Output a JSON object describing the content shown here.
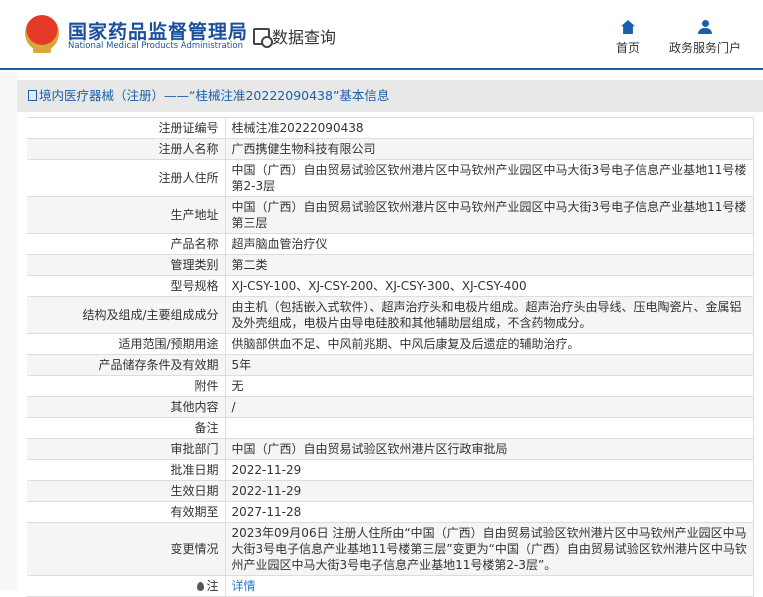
{
  "header": {
    "brand_cn": "国家药品监督管理局",
    "brand_en": "National Medical Products Administration",
    "data_query": "数据查询",
    "nav": [
      {
        "label": "首页",
        "icon": "home-icon"
      },
      {
        "label": "政务服务门户",
        "icon": "user-icon"
      }
    ]
  },
  "title": "境内医疗器械（注册）——“桂械注准20222090438”基本信息",
  "rows": [
    {
      "k": "注册证编号",
      "v": "桂械注准20222090438"
    },
    {
      "k": "注册人名称",
      "v": "广西携健生物科技有限公司"
    },
    {
      "k": "注册人住所",
      "v": "中国（广西）自由贸易试验区钦州港片区中马钦州产业园区中马大街3号电子信息产业基地11号楼第2-3层"
    },
    {
      "k": "生产地址",
      "v": "中国（广西）自由贸易试验区钦州港片区中马钦州产业园区中马大街3号电子信息产业基地11号楼第三层"
    },
    {
      "k": "产品名称",
      "v": "超声脑血管治疗仪"
    },
    {
      "k": "管理类别",
      "v": "第二类"
    },
    {
      "k": "型号规格",
      "v": "XJ-CSY-100、XJ-CSY-200、XJ-CSY-300、XJ-CSY-400"
    },
    {
      "k": "结构及组成/主要组成成分",
      "v": "由主机（包括嵌入式软件）、超声治疗头和电极片组成。超声治疗头由导线、压电陶瓷片、金属铝及外壳组成，电极片由导电硅胶和其他辅助层组成，不含药物成分。"
    },
    {
      "k": "适用范围/预期用途",
      "v": "供脑部供血不足、中风前兆期、中风后康复及后遗症的辅助治疗。"
    },
    {
      "k": "产品储存条件及有效期",
      "v": "5年"
    },
    {
      "k": "附件",
      "v": "无"
    },
    {
      "k": "其他内容",
      "v": "/"
    },
    {
      "k": "备注",
      "v": ""
    },
    {
      "k": "审批部门",
      "v": "中国（广西）自由贸易试验区钦州港片区行政审批局"
    },
    {
      "k": "批准日期",
      "v": "2022-11-29"
    },
    {
      "k": "生效日期",
      "v": "2022-11-29"
    },
    {
      "k": "有效期至",
      "v": "2027-11-28"
    },
    {
      "k": "变更情况",
      "v": "2023年09月06日 注册人住所由“中国（广西）自由贸易试验区钦州港片区中马钦州产业园区中马大街3号电子信息产业基地11号楼第三层”变更为“中国（广西）自由贸易试验区钦州港片区中马钦州产业园区中马大街3号电子信息产业基地11号楼第2-3层”。"
    }
  ],
  "note": {
    "label": "注",
    "link": "详情"
  }
}
